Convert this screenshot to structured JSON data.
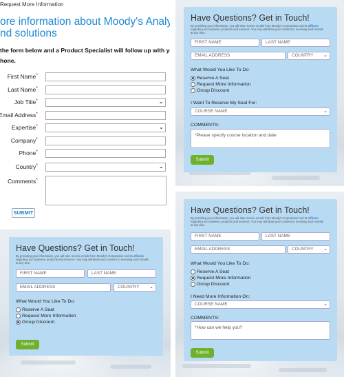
{
  "panel1": {
    "tab": "Request More Information",
    "title_lines": [
      "ore information about Moody's Analytics aw",
      "nd solutions"
    ],
    "intro_lines": [
      "the form below and a Product Specialist will follow up with you direc",
      "hone."
    ],
    "fields": [
      {
        "label": "First Name",
        "required": "*",
        "kind": "input"
      },
      {
        "label": "Last Name",
        "required": "*",
        "kind": "input"
      },
      {
        "label": "Job Title",
        "required": "*",
        "kind": "select"
      },
      {
        "label": "Email Address",
        "required": "*",
        "kind": "input"
      },
      {
        "label": "Expertise",
        "required": "*",
        "kind": "select"
      },
      {
        "label": "Company",
        "required": "*",
        "kind": "input"
      },
      {
        "label": "Phone",
        "required": "*",
        "kind": "input"
      },
      {
        "label": "Country",
        "required": "*",
        "kind": "select"
      }
    ],
    "comments_label": "Comments",
    "comments_required": "*",
    "submit": "SUBMIT"
  },
  "cards": [
    {
      "title": "Have Questions? Get in Touch!",
      "legal_line1_a": "By providing your information, you will also receive emails from Moody's Corporation and its ",
      "legal_link": "affiliates",
      "legal_line2": "regarding our business, products and services. You may withdraw your consent to receiving such emails",
      "legal_line3": "at any time.",
      "first_name": "FIRST NAME",
      "last_name": "LAST NAME",
      "email": "EMAIL ADDRESS",
      "country": "COUNTRY",
      "question": "What Would You Like To Do:",
      "options": [
        {
          "label": "Reserve A Seat",
          "selected": true
        },
        {
          "label": "Request More Information",
          "selected": false
        },
        {
          "label": "Group Discount",
          "selected": false
        }
      ],
      "select_label": "I Want To Reserve My Seat For:",
      "select_value": "COURSE NAME",
      "comments_label": "COMMENTS:",
      "comments_placeholder": "*Please specify course location and date",
      "submit": "Submit"
    },
    {
      "title": "Have Questions? Get in Touch!",
      "legal_line1_a": "By providing your information, you will also receive emails from Moody's Corporation and its ",
      "legal_link": "affiliates",
      "legal_line2": "regarding our business, products and services. You may withdraw your consent to receiving such emails",
      "legal_line3": "at any time.",
      "first_name": "FIRST NAME",
      "last_name": "LAST NAME",
      "email": "EMAIL ADDRESS",
      "country": "COUNTRY",
      "question": "What Would You Like To Do:",
      "options": [
        {
          "label": "Reserve A Seat",
          "selected": false
        },
        {
          "label": "Request More Information",
          "selected": false
        },
        {
          "label": "Group Discount",
          "selected": true
        }
      ],
      "submit": "Submit"
    },
    {
      "title": "Have Questions? Get in Touch!",
      "legal_line1_a": "By providing your information, you will also receive emails from Moody's Corporation and its ",
      "legal_link": "affiliates",
      "legal_line2": "regarding our business, products and services. You may withdraw your consent to receiving such emails",
      "legal_line3": "at any time.",
      "first_name": "FIRST NAME",
      "last_name": "LAST NAME",
      "email": "EMAIL ADDRESS",
      "country": "COUNTRY",
      "question": "What Would You Like To Do:",
      "options": [
        {
          "label": "Reserve A Seat",
          "selected": false
        },
        {
          "label": "Request More Information",
          "selected": true
        },
        {
          "label": "Group Discount",
          "selected": false
        }
      ],
      "select_label": "I Need More Information On:",
      "select_value": "COURSE NAME",
      "comments_label": "COMMENTS:",
      "comments_placeholder": "*How can we help you?",
      "submit": "Submit"
    }
  ]
}
